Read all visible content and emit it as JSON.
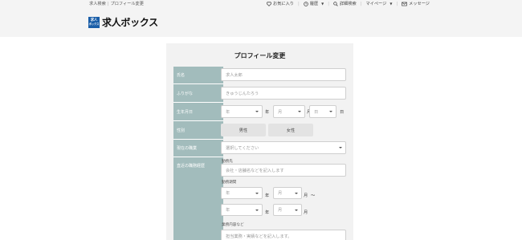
{
  "breadcrumb": [
    "求人検索",
    "プロフィール変更"
  ],
  "logo": {
    "mark": "求人ボックス",
    "mark_line1": "求人",
    "mark_line2": "ボックス",
    "text": "求人ボックス"
  },
  "nav": {
    "favorites": "お気に入り",
    "history": "履歴",
    "detailed_search": "詳細検索",
    "mypage": "マイページ",
    "messages": "メッセージ"
  },
  "form": {
    "title": "プロフィール変更",
    "labels": {
      "name": "氏名",
      "furigana": "ふりがな",
      "birthdate": "生年月日",
      "gender": "性別",
      "current_job": "現在の職業",
      "recent_history": "直近の職務経歴"
    },
    "placeholders": {
      "name": "求人太郎",
      "furigana": "きゅうじんたろう",
      "year": "年",
      "month": "月",
      "day": "日",
      "job_select": "選択してください",
      "company": "会社・店舗名などを記入します",
      "duties": "担当業務・実績などを記入します。"
    },
    "units": {
      "year": "年",
      "month": "月",
      "day": "日",
      "tilde": "～"
    },
    "gender": {
      "male": "男性",
      "female": "女性"
    },
    "history": {
      "company_label": "勤務先",
      "period_label": "勤務期間",
      "duties_label": "業務内容など"
    }
  }
}
